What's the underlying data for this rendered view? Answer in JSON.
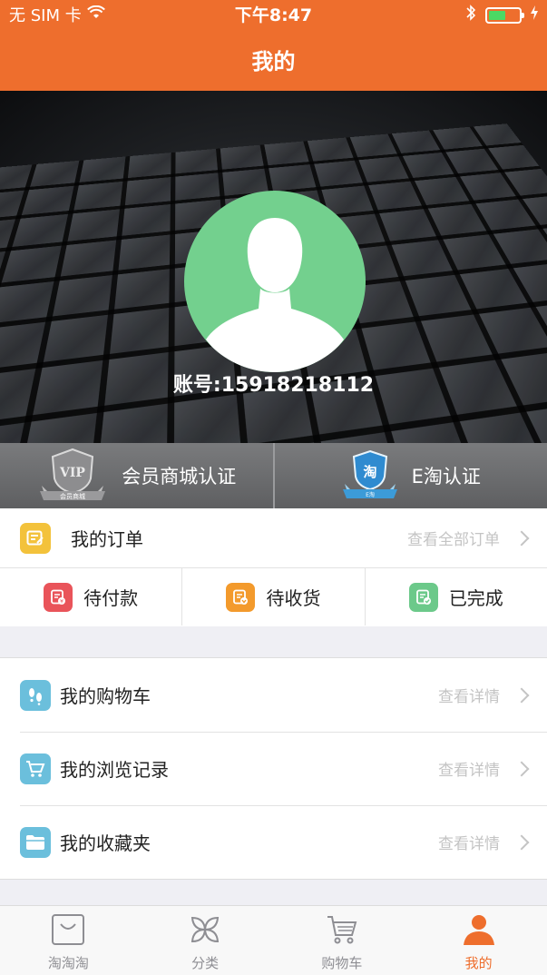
{
  "status_bar": {
    "carrier": "无 SIM 卡",
    "time": "下午8:47"
  },
  "nav": {
    "title": "我的"
  },
  "profile": {
    "account": "账号:15918218112"
  },
  "certs": [
    {
      "label": "会员商城认证",
      "badge": "VIP",
      "badge_caption": "会员商城"
    },
    {
      "label": "E淘认证",
      "badge": "淘",
      "badge_caption": "E淘"
    }
  ],
  "orders": {
    "title": "我的订单",
    "view_all": "查看全部订单",
    "states": [
      {
        "label": "待付款",
        "color": "#e9545a"
      },
      {
        "label": "待收货",
        "color": "#f39a2c"
      },
      {
        "label": "已完成",
        "color": "#6cc98a"
      }
    ]
  },
  "menu": [
    {
      "label": "我的购物车",
      "action": "查看详情",
      "icon": "footprint-icon"
    },
    {
      "label": "我的浏览记录",
      "action": "查看详情",
      "icon": "cart-icon"
    },
    {
      "label": "我的收藏夹",
      "action": "查看详情",
      "icon": "folder-icon"
    }
  ],
  "tabs": [
    {
      "label": "淘淘淘",
      "icon": "bag-icon"
    },
    {
      "label": "分类",
      "icon": "category-icon"
    },
    {
      "label": "购物车",
      "icon": "cart-icon"
    },
    {
      "label": "我的",
      "icon": "person-icon",
      "active": true
    }
  ],
  "colors": {
    "accent": "#ee6e2d",
    "avatar_bg": "#73d08e",
    "list_icon_bg": "#6bbfdc",
    "order_icon_bg": "#f3c23b"
  }
}
